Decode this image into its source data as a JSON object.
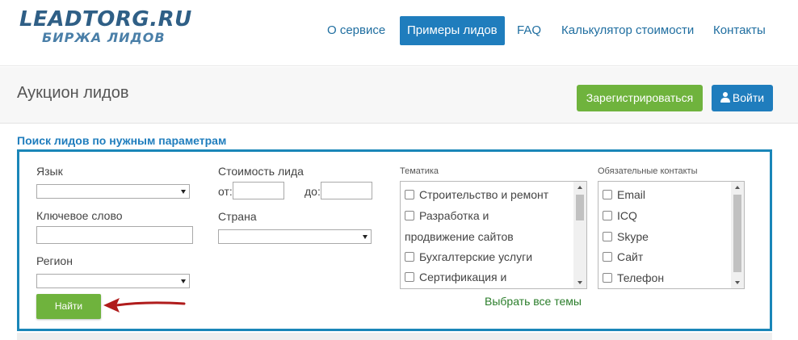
{
  "logo": {
    "main": "LEADTORG.RU",
    "sub": "БИРЖА ЛИДОВ"
  },
  "nav": {
    "items": [
      {
        "label": "О сервисе"
      },
      {
        "label": "Примеры лидов"
      },
      {
        "label": "FAQ"
      },
      {
        "label": "Калькулятор стоимости"
      },
      {
        "label": "Контакты"
      }
    ],
    "active_index": 1
  },
  "auction": {
    "title": "Аукцион лидов",
    "register_label": "Зарегистрироваться",
    "login_label": "Войти",
    "login_icon": "user-icon"
  },
  "search": {
    "title": "Поиск лидов по нужным параметрам",
    "language": {
      "label": "Язык",
      "value": ""
    },
    "keyword": {
      "label": "Ключевое слово",
      "value": ""
    },
    "region": {
      "label": "Регион",
      "value": ""
    },
    "price": {
      "label": "Стоимость лида",
      "from_label": "от:",
      "to_label": "до:",
      "from_value": "",
      "to_value": ""
    },
    "country": {
      "label": "Страна",
      "value": ""
    },
    "find_label": "Найти",
    "topics": {
      "label": "Тематика",
      "items": [
        {
          "label": "Строительство и ремонт",
          "checked": false
        },
        {
          "label": "Разработка и",
          "label2": "продвижение сайтов",
          "checked": false
        },
        {
          "label": "Бухгалтерские услуги",
          "checked": false
        },
        {
          "label": "Сертификация и",
          "checked": false
        }
      ],
      "select_all_label": "Выбрать все темы"
    },
    "contacts": {
      "label": "Обязательные контакты",
      "items": [
        {
          "label": "Email",
          "checked": false
        },
        {
          "label": "ICQ",
          "checked": false
        },
        {
          "label": "Skype",
          "checked": false
        },
        {
          "label": "Сайт",
          "checked": false
        },
        {
          "label": "Телефон",
          "checked": false
        }
      ]
    }
  },
  "colors": {
    "brand_blue": "#1f7dbd",
    "green": "#6fb33d",
    "arrow_red": "#b01c1c"
  }
}
